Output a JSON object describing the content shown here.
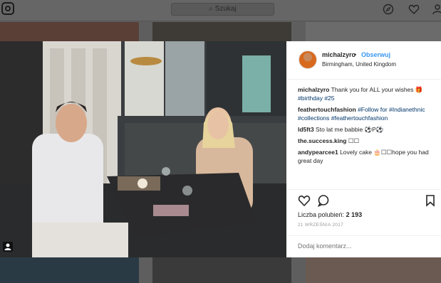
{
  "topbar": {
    "search_placeholder": "Szukaj",
    "search_icon": "search-icon",
    "icons": [
      "compass-icon",
      "heart-icon",
      "profile-icon"
    ]
  },
  "post": {
    "username": "michalzyro",
    "separator": "•",
    "follow_label": "Obserwuj",
    "location": "Birmingham, United Kingdom",
    "caption": {
      "user": "michalzyro",
      "text": "Thank you for ALL your wishes",
      "tags": "#birthday #25"
    },
    "comments": [
      {
        "user": "feathertouchfashion",
        "text": "#Follow for #Indianethnic #collections #feathertouchfashion"
      },
      {
        "user": "ld5ft3",
        "text": "Sto lat me babbie ⚽P⚽"
      },
      {
        "user": "the.success.king",
        "text": "☐☐"
      },
      {
        "user": "andypearcee1",
        "text": "Lovely cake 🎂☐☐hope you had great day"
      }
    ],
    "likes_label": "Liczba polubień:",
    "likes_count": "2 193",
    "date": "21 WRZEŚNIA 2017",
    "comment_placeholder": "Dodaj komentarz..."
  }
}
